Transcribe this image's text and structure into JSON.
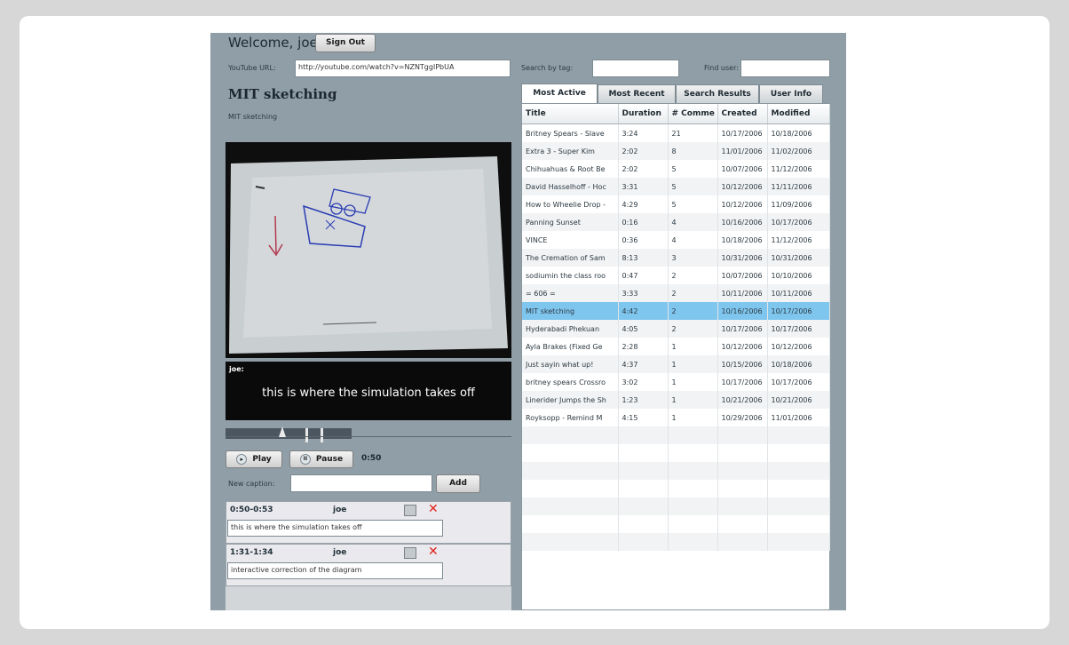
{
  "header": {
    "welcome": "Welcome, joe!",
    "sign_out": "Sign Out"
  },
  "url_field": {
    "label": "YouTube URL:",
    "value": "http://youtube.com/watch?v=NZNTgglPbUA"
  },
  "search": {
    "tag_label": "Search by tag:",
    "tag_value": "",
    "user_label": "Find user:",
    "user_value": ""
  },
  "video": {
    "title": "MIT sketching",
    "subtitle": "MIT sketching"
  },
  "caption_display": {
    "user": "joe:",
    "text": "this is where the simulation takes off"
  },
  "playback": {
    "play": "Play",
    "pause": "Pause",
    "time": "0:50",
    "position": 0.2
  },
  "new_caption": {
    "label": "New caption:",
    "value": "",
    "add": "Add"
  },
  "captions": [
    {
      "range": "0:50-0:53",
      "user": "joe",
      "text": "this is where the simulation takes off"
    },
    {
      "range": "1:31-1:34",
      "user": "joe",
      "text": "interactive correction of the diagram"
    }
  ],
  "tabs": [
    "Most Active",
    "Most Recent",
    "Search Results",
    "User Info"
  ],
  "table": {
    "columns": [
      "Title",
      "Duration",
      "# Comme",
      "Created",
      "Modified"
    ],
    "rows": [
      [
        "Britney Spears - Slave",
        "3:24",
        "21",
        "10/17/2006",
        "10/18/2006"
      ],
      [
        "Extra 3 - Super Kim",
        "2:02",
        "8",
        "11/01/2006",
        "11/02/2006"
      ],
      [
        "Chihuahuas & Root Be",
        "2:02",
        "5",
        "10/07/2006",
        "11/12/2006"
      ],
      [
        "David Hasselhoff - Hoc",
        "3:31",
        "5",
        "10/12/2006",
        "11/11/2006"
      ],
      [
        "How to Wheelie Drop -",
        "4:29",
        "5",
        "10/12/2006",
        "11/09/2006"
      ],
      [
        "Panning Sunset",
        "0:16",
        "4",
        "10/16/2006",
        "10/17/2006"
      ],
      [
        "VINCE",
        "0:36",
        "4",
        "10/18/2006",
        "11/12/2006"
      ],
      [
        "The Cremation of Sam",
        "8:13",
        "3",
        "10/31/2006",
        "10/31/2006"
      ],
      [
        "sodiumin the class roo",
        "0:47",
        "2",
        "10/07/2006",
        "10/10/2006"
      ],
      [
        "= 606 =",
        "3:33",
        "2",
        "10/11/2006",
        "10/11/2006"
      ],
      [
        "MIT sketching",
        "4:42",
        "2",
        "10/16/2006",
        "10/17/2006"
      ],
      [
        "Hyderabadi Phekuan",
        "4:05",
        "2",
        "10/17/2006",
        "10/17/2006"
      ],
      [
        "Ayla Brakes (Fixed Ge",
        "2:28",
        "1",
        "10/12/2006",
        "10/12/2006"
      ],
      [
        "Just sayin what up!",
        "4:37",
        "1",
        "10/15/2006",
        "10/18/2006"
      ],
      [
        "britney spears Crossro",
        "3:02",
        "1",
        "10/17/2006",
        "10/17/2006"
      ],
      [
        "Linerider Jumps the Sh",
        "1:23",
        "1",
        "10/21/2006",
        "10/21/2006"
      ],
      [
        "Royksopp - Remind M",
        "4:15",
        "1",
        "10/29/2006",
        "11/01/2006"
      ]
    ],
    "selected_index": 10,
    "empty_rows": 7
  },
  "colors": {
    "panel": "#8f9ea7",
    "selection": "#7fc6ef",
    "delete": "#e0251b"
  }
}
